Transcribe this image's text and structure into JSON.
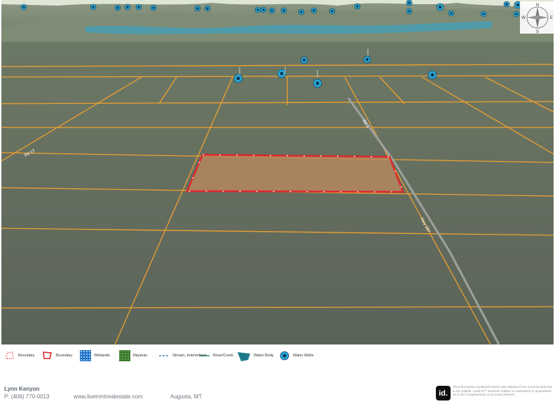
{
  "map": {
    "compass_letters": [
      "N",
      "E",
      "S",
      "W"
    ],
    "road_labels": [
      "Rd 4",
      "Hwy 287",
      "Rd 13"
    ],
    "water_well_count": 34
  },
  "legend": {
    "items": [
      {
        "label": "Boundary",
        "icon": "dotted-boundary-icon"
      },
      {
        "label": "Boundary",
        "icon": "parcel-boundary-icon"
      },
      {
        "label": "Wetlands",
        "icon": "wetlands-icon"
      },
      {
        "label": "Riparian",
        "icon": "riparian-icon"
      },
      {
        "label": "Stream, Intermittent",
        "icon": "stream-intermittent-icon"
      },
      {
        "label": "River/Creek",
        "icon": "river-creek-icon"
      },
      {
        "label": "Water Body",
        "icon": "water-body-icon"
      },
      {
        "label": "Water Wells",
        "icon": "water-well-icon"
      }
    ]
  },
  "footer": {
    "agent_name": "Lynn Kenyon",
    "phone": "P: (406) 770-0013",
    "website": "www.liveinmtrealestate.com",
    "city": "Augusta, MT",
    "logo_text": "id.",
    "disclaimer": "The information contained herein was obtained from sources deemed to be reliable. Land id™ Services makes no warranties or guarantees as to the completeness or accuracy thereof."
  },
  "colors": {
    "terrain": "#5f6a60",
    "roads": "#f0a030",
    "parcel_boundary": "#e0262b",
    "parcel_fill": "#b8865e",
    "water": "#2aa7d6"
  }
}
